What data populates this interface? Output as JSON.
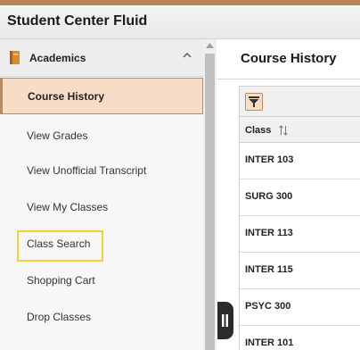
{
  "app": {
    "title": "Student Center Fluid"
  },
  "sidebar": {
    "section": {
      "label": "Academics",
      "icon": "book-icon",
      "chevron": "chevron-up-icon"
    },
    "items": [
      {
        "label": "Course History",
        "active": true
      },
      {
        "label": "View Grades"
      },
      {
        "label": "View Unofficial Transcript"
      },
      {
        "label": "View My Classes"
      },
      {
        "label": "Class Search",
        "highlighted": true
      },
      {
        "label": "Shopping Cart"
      },
      {
        "label": "Drop Classes"
      }
    ]
  },
  "main": {
    "title": "Course History",
    "filter_icon": "filter-icon",
    "grid": {
      "column_header": "Class",
      "sort_icon": "sort-icon",
      "rows": [
        "INTER 103",
        "SURG 300",
        "INTER 113",
        "INTER 115",
        "PSYC 300",
        "INTER 101"
      ]
    }
  },
  "colors": {
    "accent_fill": "#f7dcc6",
    "accent_border": "#b98a66",
    "highlight": "#f2d230",
    "header_strip": "#b48660"
  }
}
